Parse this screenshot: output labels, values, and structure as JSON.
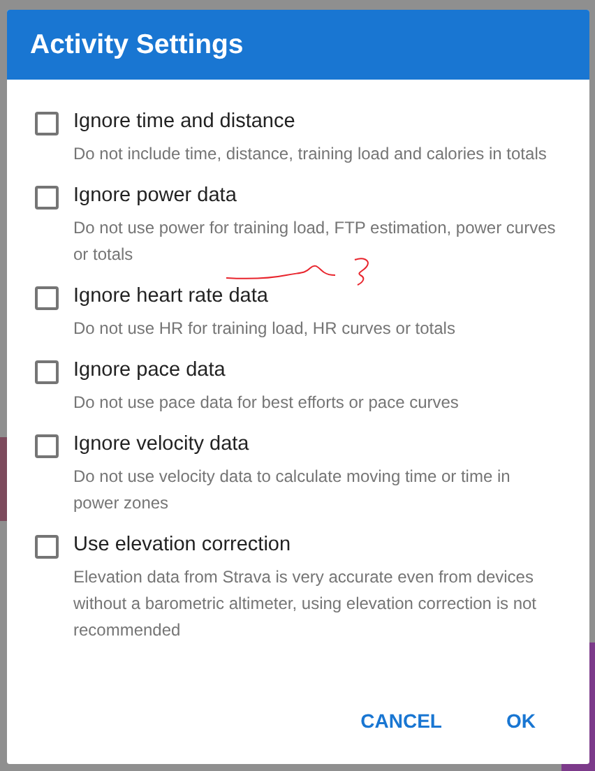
{
  "dialog": {
    "title": "Activity Settings",
    "options": [
      {
        "label": "Ignore time and distance",
        "description": "Do not include time, distance, training load and calories in totals",
        "checked": false
      },
      {
        "label": "Ignore power data",
        "description": "Do not use power for training load, FTP estimation, power curves or totals",
        "checked": false
      },
      {
        "label": "Ignore heart rate data",
        "description": "Do not use HR for training load, HR curves or totals",
        "checked": false
      },
      {
        "label": "Ignore pace data",
        "description": "Do not use pace data for best efforts or pace curves",
        "checked": false
      },
      {
        "label": "Ignore velocity data",
        "description": "Do not use velocity data to calculate moving time or time in power zones",
        "checked": false
      },
      {
        "label": "Use elevation correction",
        "description": "Elevation data from Strava is very accurate even from devices without a barometric altimeter, using elevation correction is not recommended",
        "checked": false
      }
    ],
    "buttons": [
      "CANCEL",
      "OK"
    ]
  }
}
